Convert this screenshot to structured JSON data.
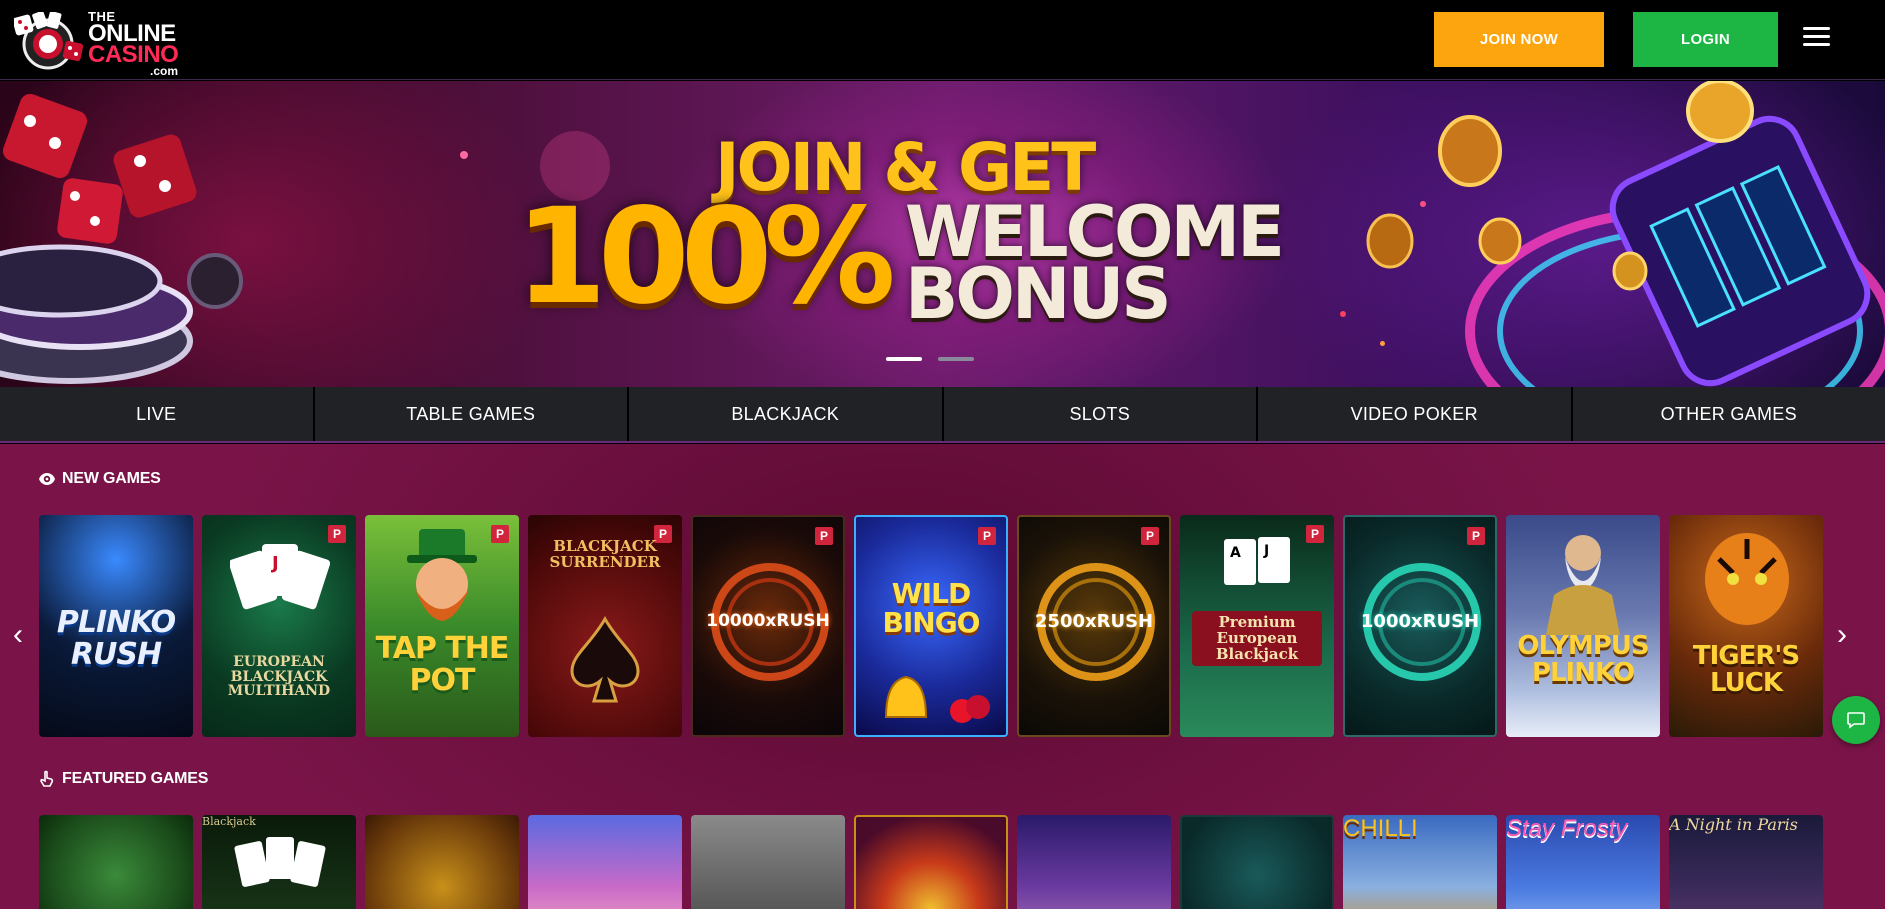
{
  "header": {
    "logo": {
      "line1": "THE",
      "line2": "ONLINE",
      "line3": "CASINO",
      "line4": ".com"
    },
    "join_label": "JOIN NOW",
    "login_label": "LOGIN",
    "menu_icon": "hamburger-icon",
    "colors": {
      "join": "#fda50f",
      "login": "#1db544"
    }
  },
  "banner": {
    "line1": "JOIN & GET",
    "percent": "100%",
    "line2a": "WELCOME",
    "line2b": "BONUS",
    "slide_count": 2,
    "active_slide": 1
  },
  "categories": [
    "LIVE",
    "TABLE GAMES",
    "BLACKJACK",
    "SLOTS",
    "VIDEO POKER",
    "OTHER GAMES"
  ],
  "new_games": {
    "title": "NEW GAMES",
    "icon": "eye-icon",
    "games": [
      {
        "label": "PLINKO RUSH",
        "badge": ""
      },
      {
        "label": "EUROPEAN BLACKJACK MULTIHAND",
        "badge": "P"
      },
      {
        "label": "TAP THE POT",
        "badge": "P"
      },
      {
        "label": "BLACKJACK SURRENDER",
        "badge": "P"
      },
      {
        "label": "10000xRUSH",
        "badge": "P"
      },
      {
        "label": "WILD BINGO",
        "badge": "P"
      },
      {
        "label": "2500xRUSH",
        "badge": "P"
      },
      {
        "label": "Premium European Blackjack",
        "badge": "P"
      },
      {
        "label": "1000xRUSH",
        "badge": "P"
      },
      {
        "label": "OLYMPUS PLINKO",
        "badge": ""
      },
      {
        "label": "TIGER'S LUCK",
        "badge": ""
      }
    ]
  },
  "featured_games": {
    "title": "FEATURED GAMES",
    "icon": "hand-pointer-icon",
    "games": [
      {
        "label": ""
      },
      {
        "label": "Blackjack"
      },
      {
        "label": ""
      },
      {
        "label": ""
      },
      {
        "label": ""
      },
      {
        "label": ""
      },
      {
        "label": ""
      },
      {
        "label": ""
      },
      {
        "label": "CHILLI"
      },
      {
        "label": "Stay Frosty"
      },
      {
        "label": "A Night in Paris"
      }
    ]
  },
  "carousel": {
    "prev_icon": "chevron-left-icon",
    "next_icon": "chevron-right-icon"
  },
  "chat": {
    "icon": "chat-bubble-icon"
  }
}
